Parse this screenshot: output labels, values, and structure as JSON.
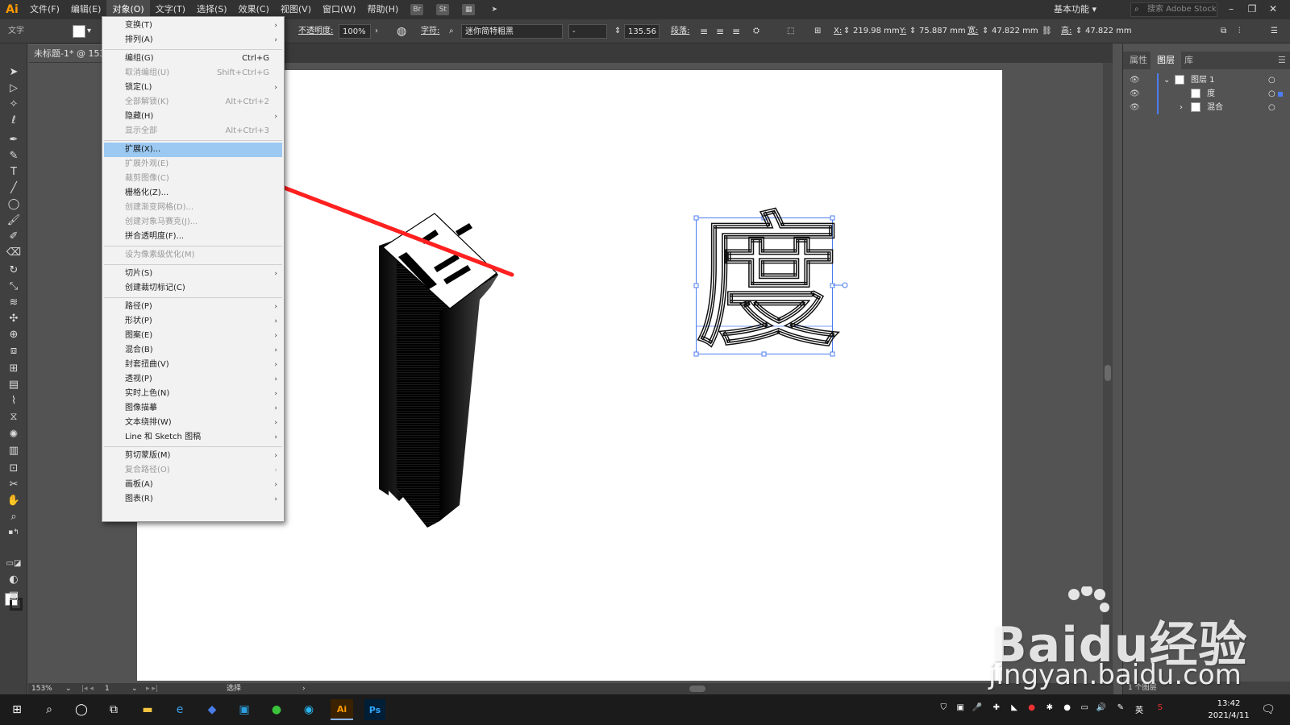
{
  "app": {
    "logo": "Ai",
    "workspace": "基本功能",
    "stock_search_placeholder": "搜索 Adobe Stock"
  },
  "menubar": {
    "items": [
      "文件(F)",
      "编辑(E)",
      "对象(O)",
      "文字(T)",
      "选择(S)",
      "效果(C)",
      "视图(V)",
      "窗口(W)",
      "帮助(H)"
    ],
    "active": "对象(O)",
    "icons": [
      "bridge-icon",
      "stock-icon",
      "arrange-documents-icon",
      "gpu-rocket-icon"
    ],
    "icon_labels": [
      "Br",
      "St"
    ]
  },
  "controlbar": {
    "type_label": "文字",
    "opacity_label": "不透明度:",
    "opacity_value": "100%",
    "character_label": "字符:",
    "font_name": "迷你简特粗黑",
    "font_style": "-",
    "font_size": "135.56",
    "paragraph_label": "段落:",
    "x_label": "X:",
    "x_value": "219.98 mm",
    "y_label": "Y:",
    "y_value": "75.887 mm",
    "w_label": "宽:",
    "w_value": "47.822 mm",
    "h_label": "高:",
    "h_value": "47.822 mm"
  },
  "document": {
    "tab_title": "未标题-1* @ 153%",
    "zoom": "153%",
    "artboard_number": "1",
    "status": "选择"
  },
  "object_menu": {
    "items": [
      {
        "label": "变换(T)",
        "shortcut": "",
        "submenu": true,
        "disabled": false
      },
      {
        "label": "排列(A)",
        "shortcut": "",
        "submenu": true,
        "disabled": false
      },
      {
        "sep": true
      },
      {
        "label": "编组(G)",
        "shortcut": "Ctrl+G",
        "submenu": false,
        "disabled": false
      },
      {
        "label": "取消编组(U)",
        "shortcut": "Shift+Ctrl+G",
        "submenu": false,
        "disabled": true
      },
      {
        "label": "锁定(L)",
        "shortcut": "",
        "submenu": true,
        "disabled": false
      },
      {
        "label": "全部解锁(K)",
        "shortcut": "Alt+Ctrl+2",
        "submenu": false,
        "disabled": true
      },
      {
        "label": "隐藏(H)",
        "shortcut": "",
        "submenu": true,
        "disabled": false
      },
      {
        "label": "显示全部",
        "shortcut": "Alt+Ctrl+3",
        "submenu": false,
        "disabled": true
      },
      {
        "sep": true
      },
      {
        "label": "扩展(X)...",
        "shortcut": "",
        "submenu": false,
        "disabled": false,
        "highlight": true
      },
      {
        "label": "扩展外观(E)",
        "shortcut": "",
        "submenu": false,
        "disabled": true
      },
      {
        "label": "裁剪图像(C)",
        "shortcut": "",
        "submenu": false,
        "disabled": true
      },
      {
        "label": "栅格化(Z)...",
        "shortcut": "",
        "submenu": false,
        "disabled": false
      },
      {
        "label": "创建渐变网格(D)...",
        "shortcut": "",
        "submenu": false,
        "disabled": true
      },
      {
        "label": "创建对象马赛克(J)...",
        "shortcut": "",
        "submenu": false,
        "disabled": true
      },
      {
        "label": "拼合透明度(F)...",
        "shortcut": "",
        "submenu": false,
        "disabled": false
      },
      {
        "sep": true
      },
      {
        "label": "设为像素级优化(M)",
        "shortcut": "",
        "submenu": false,
        "disabled": true
      },
      {
        "sep": true
      },
      {
        "label": "切片(S)",
        "shortcut": "",
        "submenu": true,
        "disabled": false
      },
      {
        "label": "创建裁切标记(C)",
        "shortcut": "",
        "submenu": false,
        "disabled": false
      },
      {
        "sep": true
      },
      {
        "label": "路径(P)",
        "shortcut": "",
        "submenu": true,
        "disabled": false
      },
      {
        "label": "形状(P)",
        "shortcut": "",
        "submenu": true,
        "disabled": false
      },
      {
        "label": "图案(E)",
        "shortcut": "",
        "submenu": true,
        "disabled": false
      },
      {
        "label": "混合(B)",
        "shortcut": "",
        "submenu": true,
        "disabled": false
      },
      {
        "label": "封套扭曲(V)",
        "shortcut": "",
        "submenu": true,
        "disabled": false
      },
      {
        "label": "透视(P)",
        "shortcut": "",
        "submenu": true,
        "disabled": false
      },
      {
        "label": "实时上色(N)",
        "shortcut": "",
        "submenu": true,
        "disabled": false
      },
      {
        "label": "图像描摹",
        "shortcut": "",
        "submenu": true,
        "disabled": false
      },
      {
        "label": "文本绕排(W)",
        "shortcut": "",
        "submenu": true,
        "disabled": false
      },
      {
        "label": "Line 和 Sketch 图稿",
        "shortcut": "",
        "submenu": true,
        "disabled": false
      },
      {
        "sep": true
      },
      {
        "label": "剪切蒙版(M)",
        "shortcut": "",
        "submenu": true,
        "disabled": false
      },
      {
        "label": "复合路径(O)",
        "shortcut": "",
        "submenu": true,
        "disabled": true
      },
      {
        "label": "画板(A)",
        "shortcut": "",
        "submenu": true,
        "disabled": false
      },
      {
        "label": "图表(R)",
        "shortcut": "",
        "submenu": true,
        "disabled": false
      }
    ]
  },
  "canvas": {
    "selected_char": "度",
    "extrude_top_char": "度"
  },
  "panels": {
    "tabs": [
      "属性",
      "图层",
      "库"
    ],
    "active_tab": "图层",
    "layers": [
      {
        "name": "图层 1",
        "expanded": true
      },
      {
        "name": "度",
        "expanded": false
      },
      {
        "name": "混合",
        "expanded": false
      }
    ],
    "footer": "1 个图层"
  },
  "taskbar": {
    "time": "13:42",
    "date": "2021/4/11",
    "ime": "英",
    "apps": [
      "windows-start-icon",
      "search-icon",
      "cortana-icon",
      "task-view-icon",
      "file-explorer-icon",
      "edge-icon",
      "app-icon",
      "app-icon",
      "wechat-icon",
      "app-icon",
      "illustrator-icon",
      "photoshop-icon"
    ],
    "app_labels": [
      "Ai",
      "Ps"
    ]
  },
  "watermark": {
    "brand": "Baidu经验",
    "url": "jingyan.baidu.com"
  },
  "colors": {
    "accent_highlight": "#9bc9f2",
    "arrow_red": "#ff2020",
    "selection_blue": "#4c7df0",
    "ai_orange": "#ff9a00"
  }
}
